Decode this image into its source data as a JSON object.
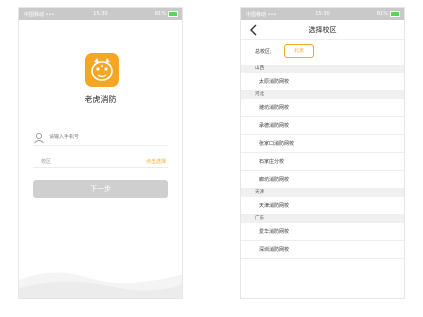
{
  "colors": {
    "accent": "#f5a623",
    "button_disabled": "#cfcfcf",
    "statusbar": "#c9c9c9",
    "group_bg": "#f0f0f0"
  },
  "left_screen": {
    "statusbar": {
      "carrier": "中国移动 •••",
      "time": "15:30",
      "battery": "81%"
    },
    "app_name": "老虎消防",
    "logo_icon": "tiger-fire-logo",
    "phone_placeholder": "请输入手机号",
    "campus_label": "校区",
    "campus_select": "点击选择",
    "next_button": "下一步"
  },
  "right_screen": {
    "statusbar": {
      "carrier": "中国移动 •••",
      "time": "15:30",
      "battery": "81%"
    },
    "title": "选择校区",
    "total_label": "总校区:",
    "total_value": "北京",
    "groups": [
      {
        "name": "山西",
        "items": [
          "太原消防网校"
        ]
      },
      {
        "name": "河北",
        "items": [
          "潍坊消防网校",
          "承德消防网校",
          "张家口消防网校",
          "石家庄分校",
          "廊坊消防网校"
        ]
      },
      {
        "name": "天津",
        "items": [
          "天津消防网校"
        ]
      },
      {
        "name": "广东",
        "items": [
          "爱华消防网校",
          "深圳消防网校"
        ]
      }
    ]
  }
}
